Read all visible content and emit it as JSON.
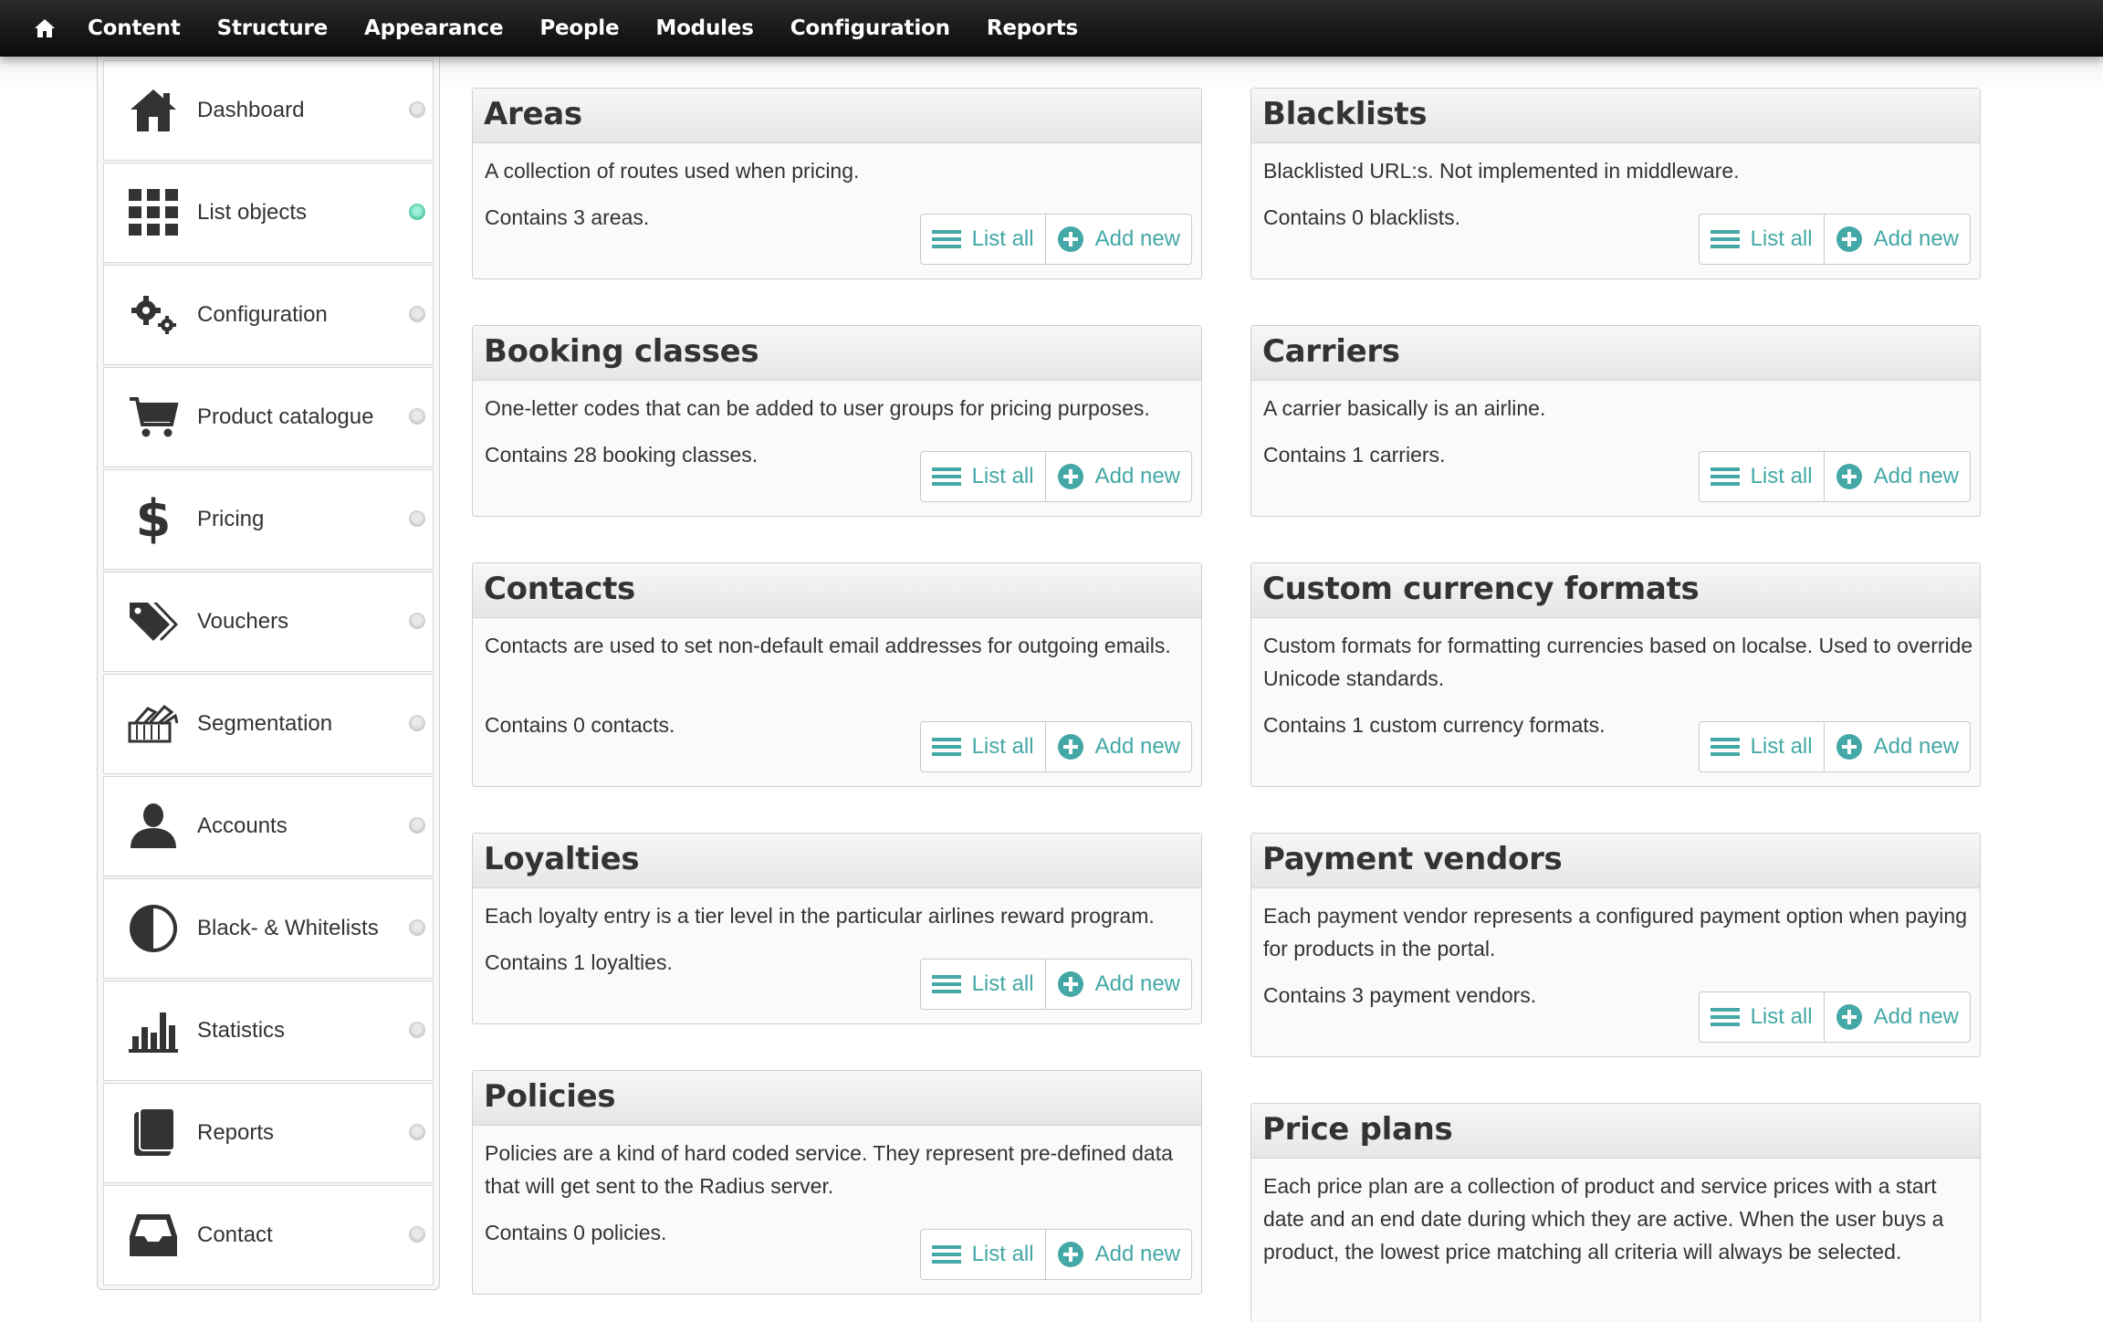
{
  "toolbar": {
    "home_icon": "home-icon",
    "items": [
      "Content",
      "Structure",
      "Appearance",
      "People",
      "Modules",
      "Configuration",
      "Reports"
    ]
  },
  "sidebar": {
    "items": [
      {
        "label": "Dashboard",
        "icon": "house-icon",
        "active": false
      },
      {
        "label": "List objects",
        "icon": "grid-icon",
        "active": true
      },
      {
        "label": "Configuration",
        "icon": "gears-icon",
        "active": false
      },
      {
        "label": "Product catalogue",
        "icon": "cart-icon",
        "active": false
      },
      {
        "label": "Pricing",
        "icon": "dollar-icon",
        "active": false
      },
      {
        "label": "Vouchers",
        "icon": "tags-icon",
        "active": false
      },
      {
        "label": "Segmentation",
        "icon": "swatches-icon",
        "active": false
      },
      {
        "label": "Accounts",
        "icon": "user-icon",
        "active": false
      },
      {
        "label": "Black- & Whitelists",
        "icon": "contrast-icon",
        "active": false
      },
      {
        "label": "Statistics",
        "icon": "bar-chart-icon",
        "active": false
      },
      {
        "label": "Reports",
        "icon": "book-icon",
        "active": false
      },
      {
        "label": "Contact",
        "icon": "inbox-icon",
        "active": false
      }
    ]
  },
  "buttons": {
    "list_all": "List all",
    "add_new": "Add new"
  },
  "accent_color": "#43a8a6",
  "cards": [
    {
      "title": "Areas",
      "description": "A collection of routes used when pricing.",
      "count": "Contains 3 areas."
    },
    {
      "title": "Blacklists",
      "description": "Blacklisted URL:s. Not implemented in middleware.",
      "count": "Contains 0 blacklists."
    },
    {
      "title": "Booking classes",
      "description": "One-letter codes that can be added to user groups for pricing purposes.",
      "count": "Contains 28 booking classes."
    },
    {
      "title": "Carriers",
      "description": "A carrier basically is an airline.",
      "count": "Contains 1 carriers."
    },
    {
      "title": "Contacts",
      "description": "Contacts are used to set non-default email addresses for outgoing emails.",
      "count": "Contains 0 contacts."
    },
    {
      "title": "Custom currency formats",
      "description": "Custom formats for formatting currencies based on localse. Used to override Unicode standards.",
      "count": "Contains 1 custom currency formats."
    },
    {
      "title": "Loyalties",
      "description": "Each loyalty entry is a tier level in the particular airlines reward program.",
      "count": "Contains 1 loyalties."
    },
    {
      "title": "Payment vendors",
      "description": "Each payment vendor represents a configured payment option when paying for products in the portal.",
      "count": "Contains 3 payment vendors."
    },
    {
      "title": "Policies",
      "description": "Policies are a kind of hard coded service. They represent pre-defined data that will get sent to the Radius server.",
      "count": "Contains 0 policies."
    },
    {
      "title": "Price plans",
      "description": "Each price plan are a collection of product and service prices with a start date and an end date during which they are active. When the user buys a product, the lowest price matching all criteria will always be selected.",
      "count": ""
    }
  ]
}
